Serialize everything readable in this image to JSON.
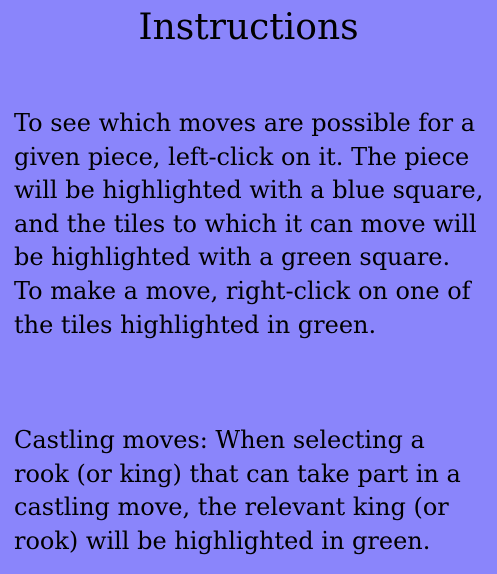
{
  "panel": {
    "title": "Instructions",
    "paragraphs": [
      "To see which moves are possible for a given piece, left-click on it. The piece will be highlighted with a blue square, and the tiles to which it can move will be highlighted with a green square. To make a move, right-click on one of the tiles highlighted in green.",
      "Castling moves: When selecting a rook (or king) that can take part in a castling move, the relevant king (or rook) will be highlighted in green."
    ]
  },
  "colors": {
    "background": "#8a85fb",
    "text": "#000000"
  }
}
